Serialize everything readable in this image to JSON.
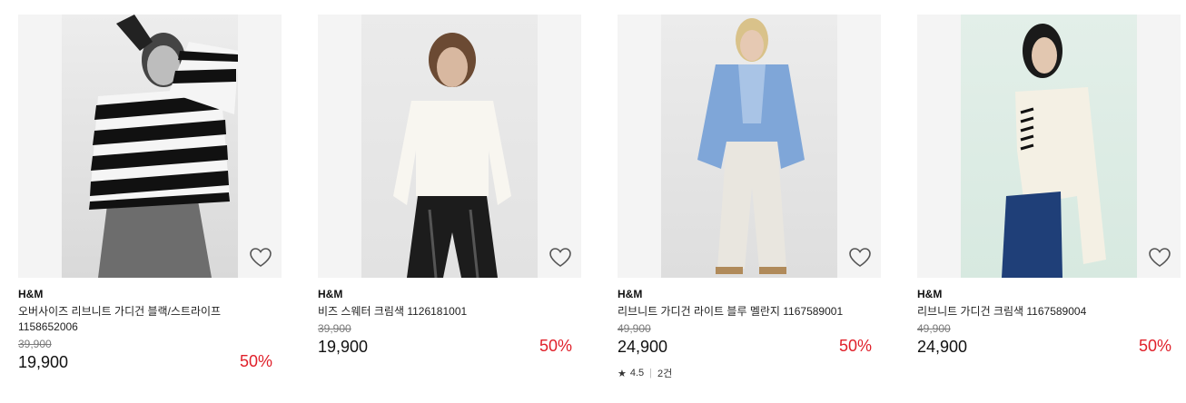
{
  "products": [
    {
      "brand": "H&M",
      "name": "오버사이즈 리브니트 가디건 블랙/스트라이프 1158652006",
      "original_price": "39,900",
      "price": "19,900",
      "discount": "50%",
      "image_icon": "model-striped-cardigan-image"
    },
    {
      "brand": "H&M",
      "name": "비즈 스웨터 크림색 1126181001",
      "original_price": "39,900",
      "price": "19,900",
      "discount": "50%",
      "image_icon": "model-cream-sweater-image"
    },
    {
      "brand": "H&M",
      "name": "리브니트 가디건 라이트 블루 멜란지 1167589001",
      "original_price": "49,900",
      "price": "24,900",
      "discount": "50%",
      "image_icon": "model-blue-cardigan-image",
      "rating": "4.5",
      "review_count": "2건"
    },
    {
      "brand": "H&M",
      "name": "리브니트 가디건 크림색 1167589004",
      "original_price": "49,900",
      "price": "24,900",
      "discount": "50%",
      "image_icon": "model-cream-cardigan-image"
    }
  ],
  "colors": {
    "discount": "#e0202a",
    "image_bg": "#f4f4f4"
  },
  "icons": {
    "wishlist": "heart-outline-icon",
    "rating": "star-icon"
  }
}
